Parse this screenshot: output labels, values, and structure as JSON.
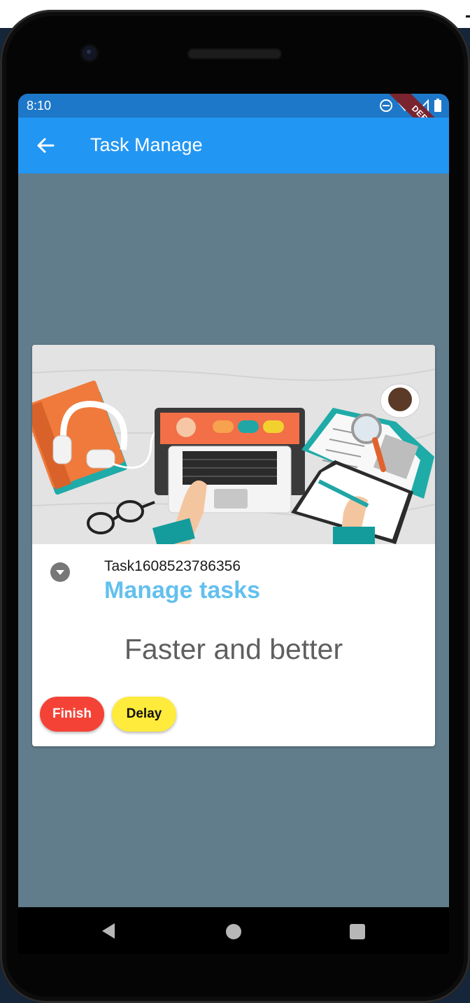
{
  "status_bar": {
    "time": "8:10",
    "debug_label": "DEBUG",
    "icons": [
      "do-not-disturb-icon",
      "wifi-icon",
      "signal-icon",
      "battery-icon"
    ]
  },
  "app_bar": {
    "title": "Task Manage",
    "back_icon": "arrow-back-icon"
  },
  "task_card": {
    "image_icon": "workspace-illustration",
    "task_id": "Task1608523786356",
    "title": "Manage tasks",
    "description": "Faster and better",
    "expand_icon": "expand-more-circle-icon",
    "buttons": {
      "finish": "Finish",
      "delay": "Delay"
    }
  },
  "navigation": {
    "back": "nav-back-icon",
    "home": "nav-home-icon",
    "recents": "nav-recents-icon"
  },
  "colors": {
    "app_bar": "#2296f3",
    "status_bar": "#1e78c9",
    "background": "#617d8b",
    "title_accent": "#63c0ee",
    "finish_button": "#f44336",
    "delay_button": "#ffeb3b"
  }
}
